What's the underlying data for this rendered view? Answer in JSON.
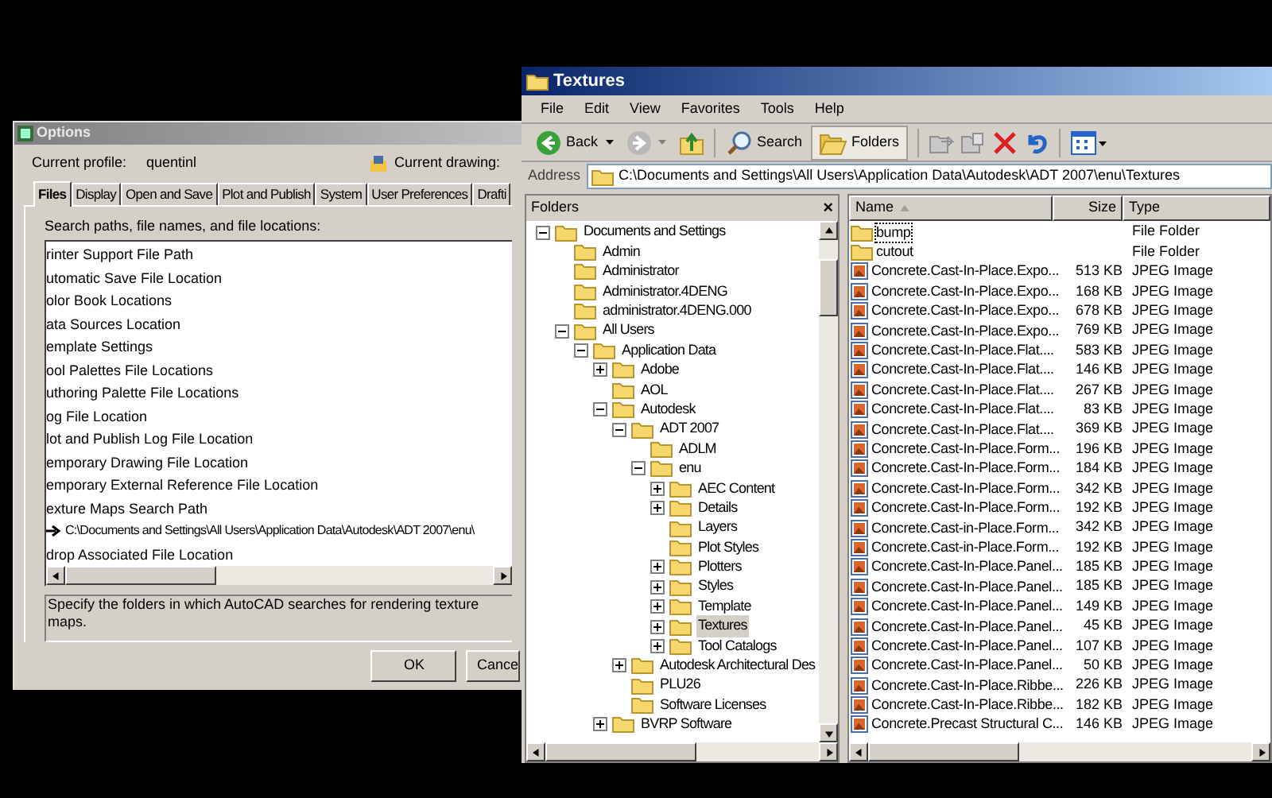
{
  "options": {
    "title": "Options",
    "profile_label": "Current profile:",
    "profile": "quentinl",
    "drawing_label": "Current drawing:",
    "tabs": [
      {
        "label": "Files",
        "selected": true
      },
      {
        "label": "Display",
        "selected": false
      },
      {
        "label": "Open and Save",
        "selected": false
      },
      {
        "label": "Plot and Publish",
        "selected": false
      },
      {
        "label": "System",
        "selected": false
      },
      {
        "label": "User Preferences",
        "selected": false
      },
      {
        "label": "Drafti",
        "selected": false
      }
    ],
    "list_label": "Search paths, file names, and file locations:",
    "items": [
      {
        "label": "rinter Support File Path"
      },
      {
        "label": "utomatic Save File Location"
      },
      {
        "label": "olor Book Locations"
      },
      {
        "label": "ata Sources Location"
      },
      {
        "label": "emplate Settings"
      },
      {
        "label": "ool Palettes File Locations"
      },
      {
        "label": "uthoring Palette File Locations"
      },
      {
        "label": "og File Location"
      },
      {
        "label": "lot and Publish Log File Location"
      },
      {
        "label": "emporary Drawing File Location"
      },
      {
        "label": "emporary External Reference File Location"
      },
      {
        "label": "exture Maps Search Path",
        "children": [
          {
            "label": "C:\\Documents and Settings\\All Users\\Application Data\\Autodesk\\ADT 2007\\enu\\"
          }
        ]
      },
      {
        "label": "drop Associated File Location"
      }
    ],
    "description": "Specify the folders in which AutoCAD searches for rendering texture maps.",
    "buttons": [
      "OK",
      "Cance"
    ]
  },
  "explorer": {
    "title": "Textures",
    "menu": [
      "File",
      "Edit",
      "View",
      "Favorites",
      "Tools",
      "Help"
    ],
    "toolbar": {
      "back": "Back",
      "search": "Search",
      "folders": {
        "label": "Folders",
        "selected": true
      }
    },
    "address_label": "Address",
    "address": "C:\\Documents and Settings\\All Users\\Application Data\\Autodesk\\ADT 2007\\enu\\Textures",
    "folders_title": "Folders",
    "folders_close": "×",
    "tree": [
      {
        "label": "Documents and Settings",
        "kind": "branch",
        "expanded": true,
        "selected": false,
        "children": [
          {
            "label": "Admin",
            "kind": "leaf",
            "selected": false
          },
          {
            "label": "Administrator",
            "kind": "leaf",
            "selected": false
          },
          {
            "label": "Administrator.4DENG",
            "kind": "leaf",
            "selected": false
          },
          {
            "label": "administrator.4DENG.000",
            "kind": "leaf",
            "selected": false
          },
          {
            "label": "All Users",
            "kind": "branch",
            "expanded": true,
            "selected": false,
            "children": [
              {
                "label": "Application Data",
                "kind": "branch",
                "expanded": true,
                "selected": false,
                "children": [
                  {
                    "label": "Adobe",
                    "kind": "branch",
                    "expanded": false,
                    "selected": false
                  },
                  {
                    "label": "AOL",
                    "kind": "leaf",
                    "selected": false
                  },
                  {
                    "label": "Autodesk",
                    "kind": "branch",
                    "expanded": true,
                    "selected": false,
                    "children": [
                      {
                        "label": "ADT 2007",
                        "kind": "branch",
                        "expanded": true,
                        "selected": false,
                        "children": [
                          {
                            "label": "ADLM",
                            "kind": "leaf",
                            "selected": false
                          },
                          {
                            "label": "enu",
                            "kind": "branch",
                            "expanded": true,
                            "selected": false,
                            "children": [
                              {
                                "label": "AEC Content",
                                "kind": "branch",
                                "expanded": false,
                                "selected": false
                              },
                              {
                                "label": "Details",
                                "kind": "branch",
                                "expanded": false,
                                "selected": false
                              },
                              {
                                "label": "Layers",
                                "kind": "leaf",
                                "selected": false
                              },
                              {
                                "label": "Plot Styles",
                                "kind": "leaf",
                                "selected": false
                              },
                              {
                                "label": "Plotters",
                                "kind": "branch",
                                "expanded": false,
                                "selected": false
                              },
                              {
                                "label": "Styles",
                                "kind": "branch",
                                "expanded": false,
                                "selected": false
                              },
                              {
                                "label": "Template",
                                "kind": "branch",
                                "expanded": false,
                                "selected": false
                              },
                              {
                                "label": "Textures",
                                "kind": "branch",
                                "expanded": false,
                                "selected": true
                              },
                              {
                                "label": "Tool Catalogs",
                                "kind": "branch",
                                "expanded": false,
                                "selected": false
                              }
                            ]
                          }
                        ]
                      },
                      {
                        "label": "Autodesk Architectural Des",
                        "kind": "branch",
                        "expanded": false,
                        "selected": false
                      },
                      {
                        "label": "PLU26",
                        "kind": "leaf",
                        "selected": false
                      },
                      {
                        "label": "Software Licenses",
                        "kind": "leaf",
                        "selected": false
                      }
                    ]
                  },
                  {
                    "label": "BVRP Software",
                    "kind": "branch",
                    "expanded": false,
                    "selected": false
                  }
                ]
              }
            ]
          }
        ]
      }
    ],
    "columns": [
      "Name",
      "Size",
      "Type"
    ],
    "files": [
      {
        "name": "bump",
        "type": "File Folder",
        "kind": "folder",
        "focused": true
      },
      {
        "name": "cutout",
        "type": "File Folder",
        "kind": "folder",
        "focused": false
      },
      {
        "name": "Concrete.Cast-In-Place.Expo...",
        "size": "513 KB",
        "type": "JPEG Image",
        "kind": "image",
        "focused": false
      },
      {
        "name": "Concrete.Cast-In-Place.Expo...",
        "size": "168 KB",
        "type": "JPEG Image",
        "kind": "image",
        "focused": false
      },
      {
        "name": "Concrete.Cast-In-Place.Expo...",
        "size": "678 KB",
        "type": "JPEG Image",
        "kind": "image",
        "focused": false
      },
      {
        "name": "Concrete.Cast-In-Place.Expo...",
        "size": "769 KB",
        "type": "JPEG Image",
        "kind": "image",
        "focused": false
      },
      {
        "name": "Concrete.Cast-In-Place.Flat....",
        "size": "583 KB",
        "type": "JPEG Image",
        "kind": "image",
        "focused": false
      },
      {
        "name": "Concrete.Cast-In-Place.Flat....",
        "size": "146 KB",
        "type": "JPEG Image",
        "kind": "image",
        "focused": false
      },
      {
        "name": "Concrete.Cast-In-Place.Flat....",
        "size": "267 KB",
        "type": "JPEG Image",
        "kind": "image",
        "focused": false
      },
      {
        "name": "Concrete.Cast-In-Place.Flat....",
        "size": "83 KB",
        "type": "JPEG Image",
        "kind": "image",
        "focused": false
      },
      {
        "name": "Concrete.Cast-In-Place.Flat....",
        "size": "369 KB",
        "type": "JPEG Image",
        "kind": "image",
        "focused": false
      },
      {
        "name": "Concrete.Cast-In-Place.Form...",
        "size": "196 KB",
        "type": "JPEG Image",
        "kind": "image",
        "focused": false
      },
      {
        "name": "Concrete.Cast-In-Place.Form...",
        "size": "184 KB",
        "type": "JPEG Image",
        "kind": "image",
        "focused": false
      },
      {
        "name": "Concrete.Cast-In-Place.Form...",
        "size": "342 KB",
        "type": "JPEG Image",
        "kind": "image",
        "focused": false
      },
      {
        "name": "Concrete.Cast-In-Place.Form...",
        "size": "192 KB",
        "type": "JPEG Image",
        "kind": "image",
        "focused": false
      },
      {
        "name": "Concrete.Cast-in-Place.Form...",
        "size": "342 KB",
        "type": "JPEG Image",
        "kind": "image",
        "focused": false
      },
      {
        "name": "Concrete.Cast-in-Place.Form...",
        "size": "192 KB",
        "type": "JPEG Image",
        "kind": "image",
        "focused": false
      },
      {
        "name": "Concrete.Cast-In-Place.Panel...",
        "size": "185 KB",
        "type": "JPEG Image",
        "kind": "image",
        "focused": false
      },
      {
        "name": "Concrete.Cast-In-Place.Panel...",
        "size": "185 KB",
        "type": "JPEG Image",
        "kind": "image",
        "focused": false
      },
      {
        "name": "Concrete.Cast-In-Place.Panel...",
        "size": "149 KB",
        "type": "JPEG Image",
        "kind": "image",
        "focused": false
      },
      {
        "name": "Concrete.Cast-In-Place.Panel...",
        "size": "45 KB",
        "type": "JPEG Image",
        "kind": "image",
        "focused": false
      },
      {
        "name": "Concrete.Cast-In-Place.Panel...",
        "size": "107 KB",
        "type": "JPEG Image",
        "kind": "image",
        "focused": false
      },
      {
        "name": "Concrete.Cast-In-Place.Panel...",
        "size": "50 KB",
        "type": "JPEG Image",
        "kind": "image",
        "focused": false
      },
      {
        "name": "Concrete.Cast-In-Place.Ribbe...",
        "size": "226 KB",
        "type": "JPEG Image",
        "kind": "image",
        "focused": false
      },
      {
        "name": "Concrete.Cast-In-Place.Ribbe...",
        "size": "182 KB",
        "type": "JPEG Image",
        "kind": "image",
        "focused": false
      },
      {
        "name": "Concrete.Precast Structural C...",
        "size": "146 KB",
        "type": "JPEG Image",
        "kind": "image",
        "focused": false
      }
    ]
  }
}
